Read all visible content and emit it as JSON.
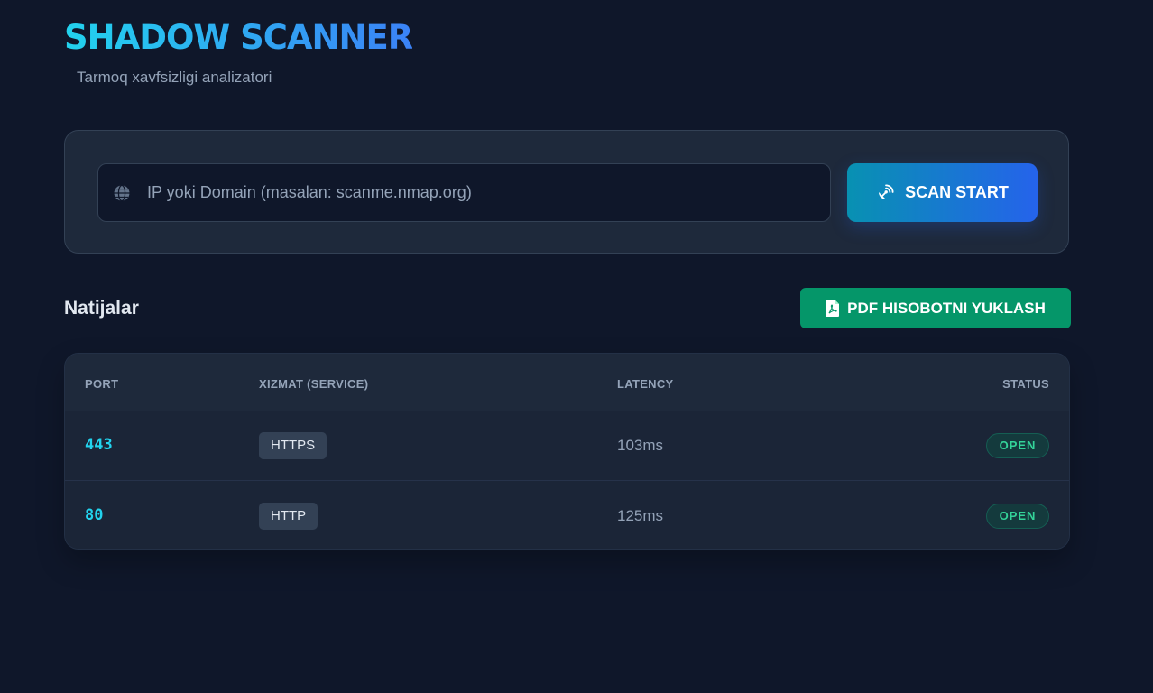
{
  "app": {
    "title": "SHADOW SCANNER",
    "subtitle": "Tarmoq xavfsizligi analizatori"
  },
  "scan": {
    "input_placeholder": "IP yoki Domain (masalan: scanme.nmap.org)",
    "input_value": "",
    "input_icon": "globe-icon",
    "button_label": "SCAN START",
    "button_icon": "satellite-dish-icon"
  },
  "results": {
    "title": "Natijalar",
    "pdf_button_label": "PDF HISOBOTNI YUKLASH",
    "pdf_button_icon": "file-pdf-icon",
    "columns": [
      "PORT",
      "XIZMAT (SERVICE)",
      "LATENCY",
      "STATUS"
    ],
    "rows": [
      {
        "port": "443",
        "service": "HTTPS",
        "latency": "103ms",
        "status": "OPEN"
      },
      {
        "port": "80",
        "service": "HTTP",
        "latency": "125ms",
        "status": "OPEN"
      }
    ]
  },
  "colors": {
    "background": "#0f172a",
    "card": "#1e293b",
    "accent_cyan": "#22d3ee",
    "accent_blue": "#3b82f6",
    "pdf_green": "#059669",
    "status_open": "#34d399"
  }
}
